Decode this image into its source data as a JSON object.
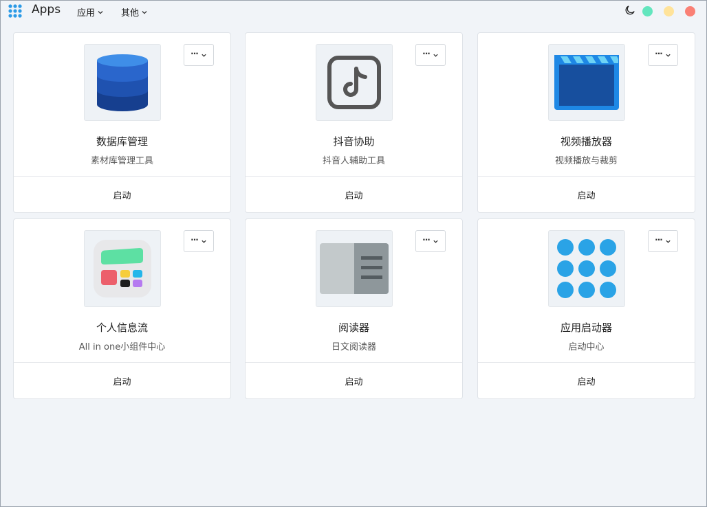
{
  "header": {
    "title": "Apps",
    "menus": [
      {
        "label": "应用"
      },
      {
        "label": "其他"
      }
    ]
  },
  "window_controls": {
    "colors": {
      "green": "#63e6be",
      "yellow": "#ffe39a",
      "red": "#fa8075"
    }
  },
  "apps": [
    {
      "title": "数据库管理",
      "subtitle": "素材库管理工具",
      "launch_label": "启动",
      "menu_label": "···",
      "icon": "database-icon"
    },
    {
      "title": "抖音协助",
      "subtitle": "抖音人辅助工具",
      "launch_label": "启动",
      "menu_label": "···",
      "icon": "tiktok-icon"
    },
    {
      "title": "视频播放器",
      "subtitle": "视频播放与裁剪",
      "launch_label": "启动",
      "menu_label": "···",
      "icon": "clapperboard-icon"
    },
    {
      "title": "个人信息流",
      "subtitle": "All in one小组件中心",
      "launch_label": "启动",
      "menu_label": "···",
      "icon": "widgets-icon"
    },
    {
      "title": "阅读器",
      "subtitle": "日文阅读器",
      "launch_label": "启动",
      "menu_label": "···",
      "icon": "reader-icon"
    },
    {
      "title": "应用启动器",
      "subtitle": "启动中心",
      "launch_label": "启动",
      "menu_label": "···",
      "icon": "app-grid-icon"
    }
  ]
}
